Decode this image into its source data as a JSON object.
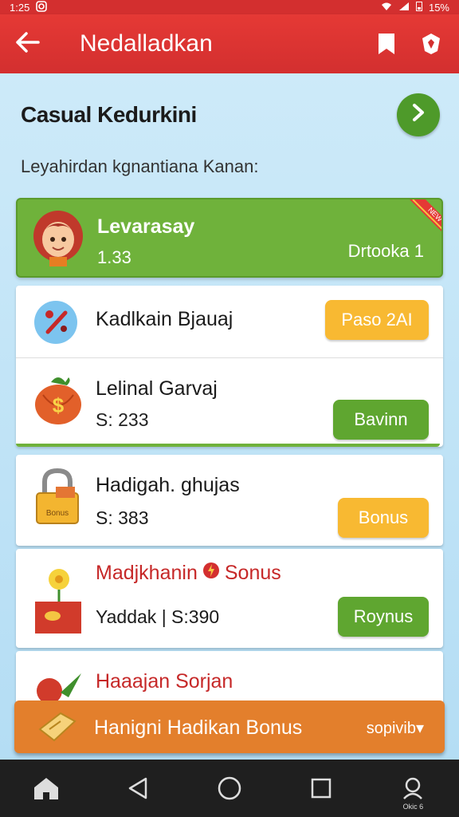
{
  "status_bar": {
    "time": "1:25",
    "battery": "15%"
  },
  "app_bar": {
    "title": "Nedalladkan",
    "back_icon": "arrow-left-icon",
    "actions": [
      "bookmark-icon",
      "shield-icon"
    ]
  },
  "section": {
    "title": "Casual Kedurkini",
    "subtitle": "Leyahirdan kgnantiana Kanan:"
  },
  "featured": {
    "name": "Levarasay",
    "value": "1.33",
    "right_label": "Drtooka 1",
    "ribbon": "NEW"
  },
  "items": [
    {
      "label": "Kadlkain Bjauaj",
      "sub": "",
      "button": "Paso 2AI",
      "button_color": "#f8b932"
    },
    {
      "label": "Lelinal Garvaj",
      "sub": "S: 233",
      "button": "Bavinn",
      "button_color": "#5fa630"
    },
    {
      "label": "Hadigah. ghujas",
      "sub": "S: 383",
      "button": "Bonus",
      "button_color": "#f8b932",
      "icon_label": "Bonus"
    },
    {
      "label_left": "Madjkhanin",
      "label_right": "Sonus",
      "sub": "Yaddak | S:390",
      "button": "Roynus",
      "button_color": "#5fa630"
    },
    {
      "label": "Haaajan Sorjan"
    }
  ],
  "bonus_bar": {
    "label": "Hanigni Hadikan Bonus",
    "right": "sopivib▾"
  },
  "nav": {
    "home_caption": "",
    "profile_caption": "Okic 6"
  }
}
